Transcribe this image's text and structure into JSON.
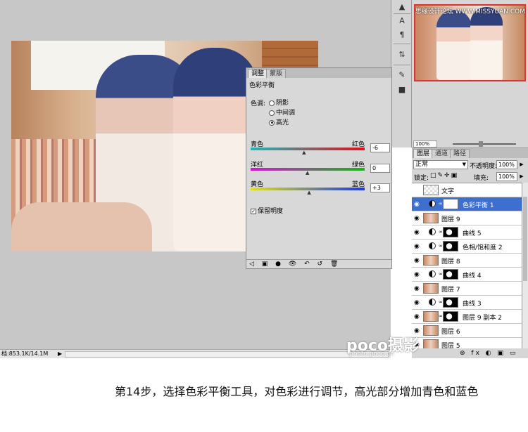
{
  "colors": {
    "selected_layer": "#3d6fd0",
    "canvas_bg": "#c7c7c7",
    "panel_bg": "#d6d6d6"
  },
  "watermark": "思缘设计论坛 WWW.MISSYUAN.COM",
  "status": {
    "doc_size": "档:853.1K/14.1M"
  },
  "navigator": {
    "zoom": "100%"
  },
  "adjust_panel": {
    "tabs": [
      "调整",
      "蒙版"
    ],
    "title": "色彩平衡",
    "tone_label": "色调:",
    "tones": [
      "阴影",
      "中间调",
      "高光"
    ],
    "selected_tone": "高光",
    "sliders": [
      {
        "left": "青色",
        "right": "红色",
        "value": "-6",
        "level": -6
      },
      {
        "left": "洋红",
        "right": "绿色",
        "value": "0",
        "level": 0
      },
      {
        "left": "黄色",
        "right": "蓝色",
        "value": "+3",
        "level": 3
      }
    ],
    "preserve_luminosity": "保留明度"
  },
  "layers_panel": {
    "tabs": [
      "图层",
      "通道",
      "路径"
    ],
    "blend_mode": "正常",
    "opacity_label": "不透明度:",
    "opacity": "100%",
    "lock_label": "锁定:",
    "fill_label": "填充:",
    "fill": "100%",
    "layers": [
      {
        "name": "文字",
        "kind": "text"
      },
      {
        "name": "色彩平衡 1",
        "kind": "adjust",
        "mask": "white",
        "selected": true
      },
      {
        "name": "图层 9",
        "kind": "photo"
      },
      {
        "name": "曲线 5",
        "kind": "adjust",
        "mask": "blob"
      },
      {
        "name": "色相/饱和度 2",
        "kind": "adjust",
        "mask": "blob"
      },
      {
        "name": "图层 8",
        "kind": "photo"
      },
      {
        "name": "曲线 4",
        "kind": "adjust",
        "mask": "blob"
      },
      {
        "name": "图层 7",
        "kind": "photo"
      },
      {
        "name": "曲线 3",
        "kind": "adjust",
        "mask": "blob"
      },
      {
        "name": "图层 9 副本 2",
        "kind": "photo-mask"
      },
      {
        "name": "图层 6",
        "kind": "photo"
      },
      {
        "name": "图层 5",
        "kind": "photo"
      }
    ]
  },
  "brand": {
    "name": "poco摄影",
    "sub": "photo.poco.cn"
  },
  "caption": "第14步，选择色彩平衡工具，对色彩进行调节，高光部分增加青色和蓝色"
}
